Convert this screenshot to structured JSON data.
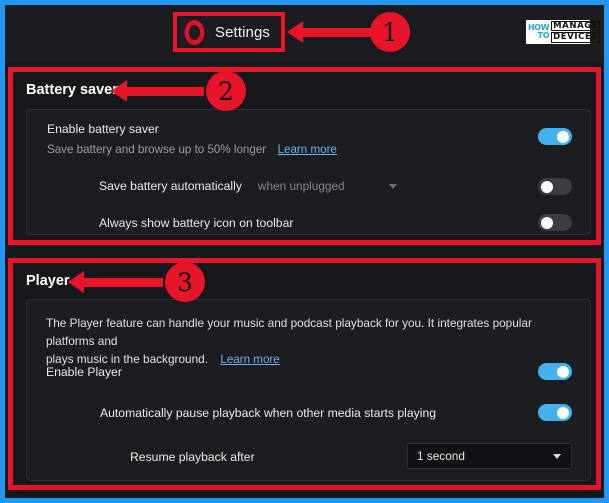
{
  "window": {
    "outer_border_color": "#2196f3",
    "page_background": "#17181c",
    "accent_annotation_color": "#e8142a",
    "toggle_on_color": "#44b0f0",
    "toggle_off_color": "#3b3d43",
    "link_color": "#6fb3e8"
  },
  "header": {
    "app_logo_name": "opera-logo",
    "title": "Settings",
    "watermark": {
      "how": "HOW",
      "to": "TO",
      "manage": "MANAGE",
      "devices": "DEVICES"
    }
  },
  "annotations": [
    {
      "number": "1",
      "target": "Settings"
    },
    {
      "number": "2",
      "target": "Battery saver"
    },
    {
      "number": "3",
      "target": "Player"
    }
  ],
  "battery_saver": {
    "section_title": "Battery saver",
    "enable": {
      "label": "Enable battery saver",
      "description": "Save battery and browse up to 50% longer",
      "learn_more": "Learn more",
      "toggle_state": "on"
    },
    "auto": {
      "label": "Save battery automatically",
      "select_value": "when unplugged",
      "toggle_state": "off"
    },
    "toolbar_icon": {
      "label": "Always show battery icon on toolbar",
      "toggle_state": "off"
    }
  },
  "player": {
    "section_title": "Player",
    "description_line1": "The Player feature can handle your music and podcast playback for you. It integrates popular platforms and",
    "description_line2": "plays music in the background.",
    "learn_more": "Learn more",
    "enable": {
      "label": "Enable Player",
      "toggle_state": "on"
    },
    "auto_pause": {
      "label": "Automatically pause playback when other media starts playing",
      "toggle_state": "on"
    },
    "resume": {
      "label": "Resume playback after",
      "select_value": "1 second"
    }
  }
}
